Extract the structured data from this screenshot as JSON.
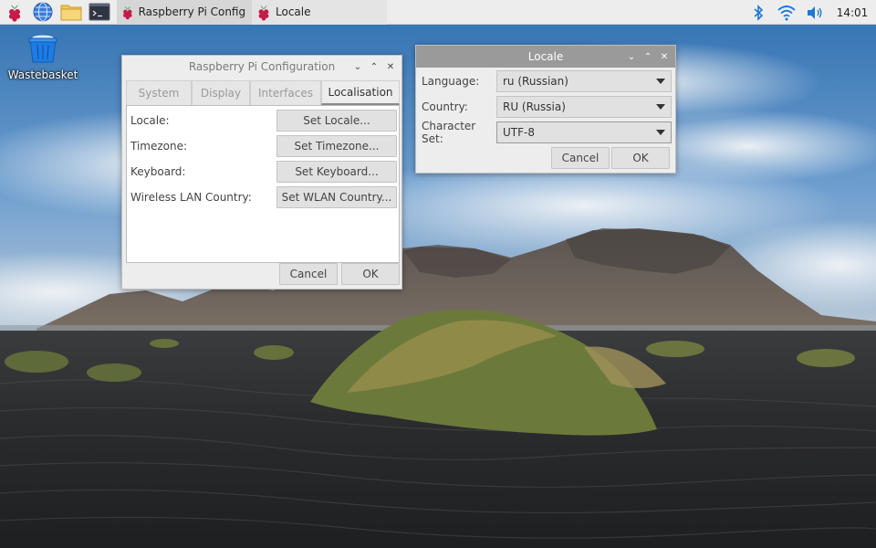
{
  "colors": {
    "taskbar_bg": "#ededed",
    "active_task_bg": "#d6d6d6",
    "window_bg": "#ededed",
    "active_titlebar": "#9a9a9a",
    "raspberry_red": "#c51a4a",
    "bluetooth_blue": "#1f78d1"
  },
  "taskbar": {
    "launchers": [
      "raspberry-menu-icon",
      "web-browser-icon",
      "file-manager-icon",
      "terminal-icon"
    ],
    "tasks": [
      {
        "label": "Raspberry Pi Configu...",
        "icon": "raspberry-icon",
        "active": true
      },
      {
        "label": "Locale",
        "icon": "raspberry-icon",
        "active": false
      }
    ],
    "tray": [
      "bluetooth-icon",
      "wifi-icon",
      "volume-icon"
    ],
    "clock": "14:01"
  },
  "desktop": {
    "wastebasket_label": "Wastebasket"
  },
  "config_window": {
    "title": "Raspberry Pi Configuration",
    "tabs": [
      {
        "label": "System",
        "active": false
      },
      {
        "label": "Display",
        "active": false
      },
      {
        "label": "Interfaces",
        "active": false
      },
      {
        "label": "Localisation",
        "active": true
      }
    ],
    "rows": [
      {
        "label": "Locale:",
        "button": "Set Locale..."
      },
      {
        "label": "Timezone:",
        "button": "Set Timezone..."
      },
      {
        "label": "Keyboard:",
        "button": "Set Keyboard..."
      },
      {
        "label": "Wireless LAN Country:",
        "button": "Set WLAN Country..."
      }
    ],
    "cancel": "Cancel",
    "ok": "OK"
  },
  "locale_window": {
    "title": "Locale",
    "fields": [
      {
        "label": "Language:",
        "value": "ru (Russian)"
      },
      {
        "label": "Country:",
        "value": "RU (Russia)"
      },
      {
        "label": "Character Set:",
        "value": "UTF-8"
      }
    ],
    "cancel": "Cancel",
    "ok": "OK"
  }
}
